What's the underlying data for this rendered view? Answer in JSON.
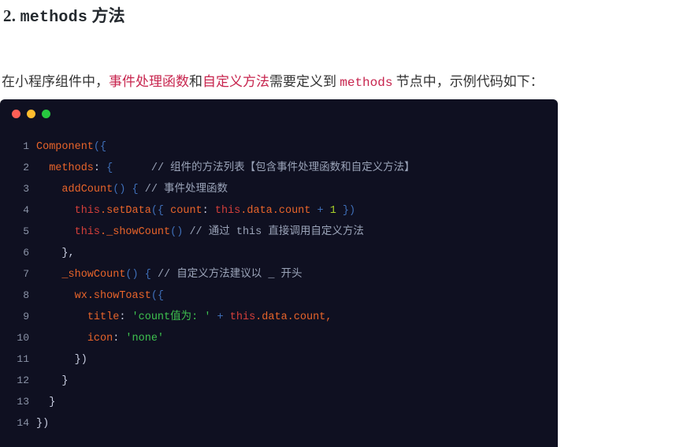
{
  "heading": {
    "number": "2.",
    "mono_term": "methods",
    "cn_term": "方法"
  },
  "paragraph": {
    "part1": "在小程序组件中，",
    "red1": "事件处理函数",
    "part2": "和",
    "red2": "自定义方法",
    "part3": "需要定义到 ",
    "code_term": "methods",
    "part4": " 节点中，示例代码如下："
  },
  "code_block": {
    "window_dots": [
      "close-dot",
      "minimize-dot",
      "maximize-dot"
    ],
    "dot_colors": {
      "red": "#ff5f56",
      "yellow": "#ffbd2e",
      "green": "#27c93f"
    },
    "background": "#0f1021",
    "language": "javascript",
    "lines": [
      {
        "n": "1",
        "text": "Component({"
      },
      {
        "n": "2",
        "text": "  methods: {      // 组件的方法列表【包含事件处理函数和自定义方法】"
      },
      {
        "n": "3",
        "text": "    addCount() { // 事件处理函数"
      },
      {
        "n": "4",
        "text": "      this.setData({ count: this.data.count + 1 })"
      },
      {
        "n": "5",
        "text": "      this._showCount() // 通过 this 直接调用自定义方法"
      },
      {
        "n": "6",
        "text": "    },"
      },
      {
        "n": "7",
        "text": "    _showCount() { // 自定义方法建议以 _ 开头"
      },
      {
        "n": "8",
        "text": "      wx.showToast({"
      },
      {
        "n": "9",
        "text": "        title: 'count值为: ' + this.data.count,"
      },
      {
        "n": "10",
        "text": "        icon: 'none'"
      },
      {
        "n": "11",
        "text": "      })"
      },
      {
        "n": "12",
        "text": "    }"
      },
      {
        "n": "13",
        "text": "  }"
      },
      {
        "n": "14",
        "text": "})"
      }
    ],
    "line_numbers": [
      "1",
      "2",
      "3",
      "4",
      "5",
      "6",
      "7",
      "8",
      "9",
      "10",
      "11",
      "12",
      "13",
      "14"
    ],
    "tokens": {
      "l1_fn": "Component",
      "l1_punc": "({",
      "l2_prop": "methods",
      "l2_colon": ": ",
      "l2_brace": "{",
      "l2_comment": "// 组件的方法列表【包含事件处理函数和自定义方法】",
      "l3_fn": "addCount",
      "l3_parens": "()",
      "l3_brace": " { ",
      "l3_comment": "// 事件处理函数",
      "l4_this": "this",
      "l4_method": ".setData",
      "l4_open": "({ ",
      "l4_prop": "count",
      "l4_colon": ": ",
      "l4_this2": "this",
      "l4_chain": ".data.count",
      "l4_plus": " + ",
      "l4_num": "1",
      "l4_close": " })",
      "l5_this": "this",
      "l5_method": "._showCount",
      "l5_parens": "()",
      "l5_comment": " // 通过 this 直接调用自定义方法",
      "l6_text": "},",
      "l7_fn": "_showCount",
      "l7_parens": "()",
      "l7_brace": " { ",
      "l7_comment": "// 自定义方法建议以 _ 开头",
      "l8_obj": "wx",
      "l8_method": ".showToast",
      "l8_open": "({",
      "l9_prop": "title",
      "l9_colon": ": ",
      "l9_str": "'count值为: '",
      "l9_plus": " + ",
      "l9_this": "this",
      "l9_chain": ".data.count",
      "l9_comma": ",",
      "l10_prop": "icon",
      "l10_colon": ": ",
      "l10_str": "'none'",
      "l11_text": "})",
      "l12_text": "}",
      "l13_text": "}",
      "l14_text": "})"
    }
  }
}
